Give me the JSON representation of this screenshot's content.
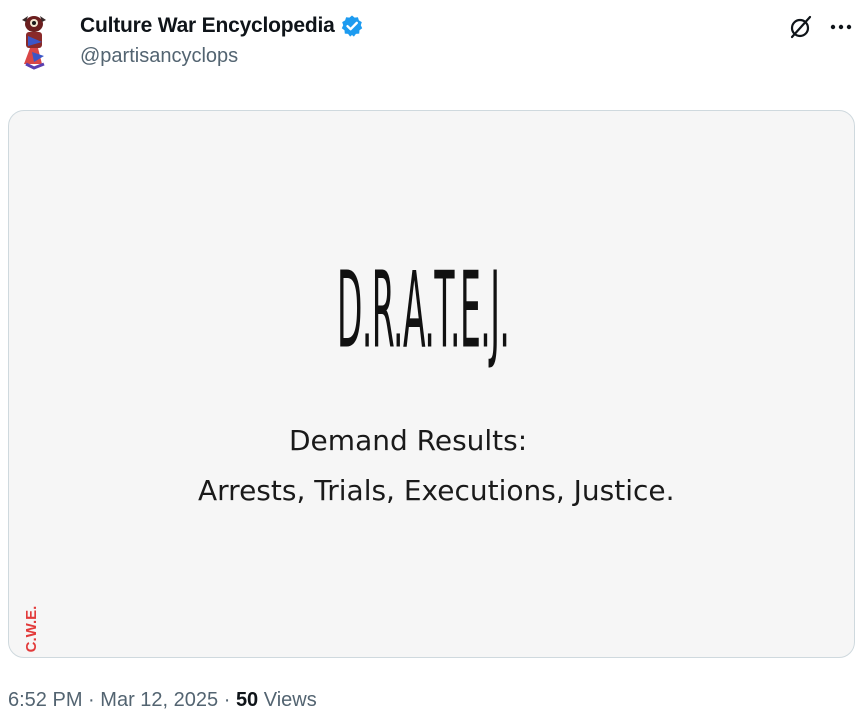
{
  "author": {
    "display_name": "Culture War Encyclopedia",
    "handle": "@partisancyclops",
    "verified": true,
    "avatar_icon": "cyclops-avatar"
  },
  "actions": {
    "grok_icon": "grok-icon",
    "more_icon": "more-options-icon"
  },
  "media": {
    "acronym": "D.R.A.T.E.J.",
    "headline": "Demand Results:",
    "subline": "Arrests, Trials, Executions, Justice.",
    "watermark": "C.W.E."
  },
  "meta": {
    "time": "6:52 PM",
    "separator": "·",
    "date": "Mar 12, 2025",
    "views_count": "50",
    "views_label": "Views"
  },
  "colors": {
    "verified_blue": "#1d9bf0",
    "watermark_red": "#e23b3b",
    "secondary_text": "#536471",
    "media_bg": "#f6f6f6"
  }
}
